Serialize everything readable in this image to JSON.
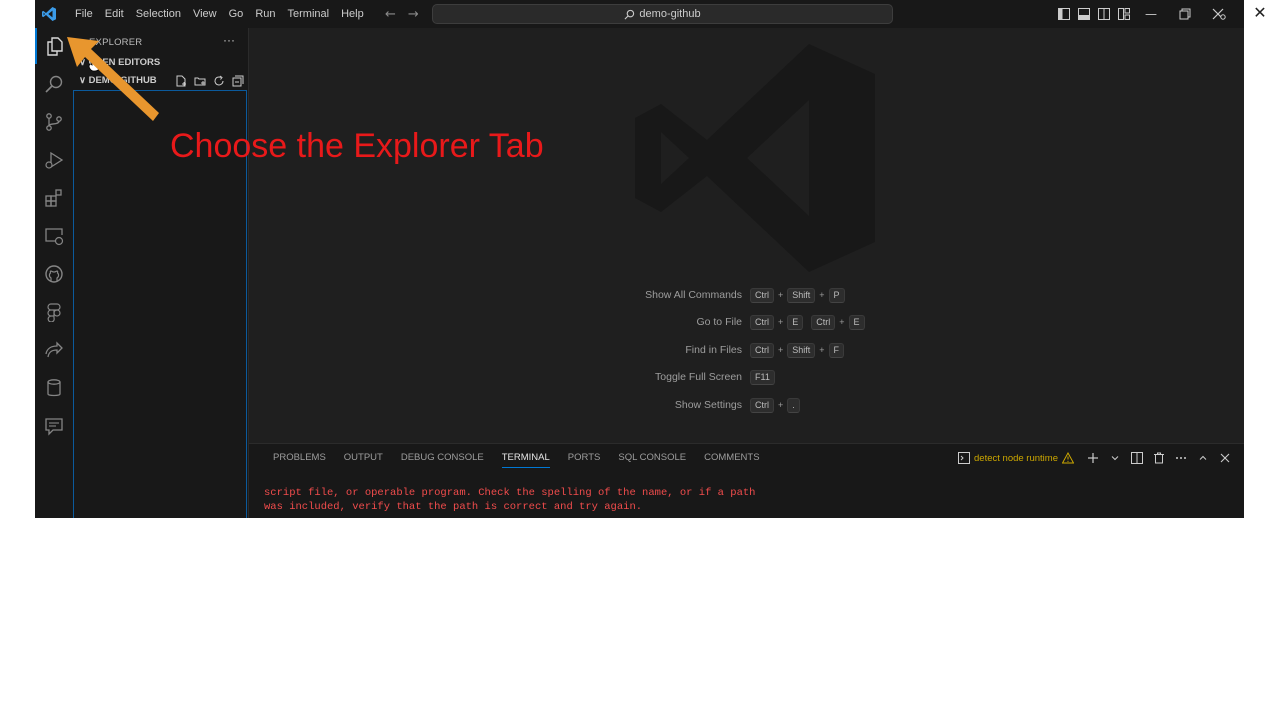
{
  "title_bar": {
    "menu": [
      "File",
      "Edit",
      "Selection",
      "View",
      "Go",
      "Run",
      "Terminal",
      "Help"
    ],
    "search_text": "demo-github",
    "nav_back": "←",
    "nav_forward": "→",
    "minimize": "—",
    "close": "✕"
  },
  "outer_close": "✕",
  "activity_bar": {
    "items": [
      "explorer-icon",
      "search-icon",
      "source-control-icon",
      "run-debug-icon",
      "extensions-icon",
      "remote-explorer-icon",
      "github-icon",
      "figma-icon",
      "live-share-icon",
      "database-icon",
      "comments-icon"
    ]
  },
  "sidebar": {
    "title": "EXPLORER",
    "more": "···",
    "open_editors": "∨  OPEN EDITORS",
    "folder": "∨  DEMO-GITHUB"
  },
  "welcome": {
    "shortcuts": [
      {
        "label": "Show All Commands",
        "keys": [
          "Ctrl",
          "+",
          "Shift",
          "+",
          "P"
        ]
      },
      {
        "label": "Go to File",
        "keys": [
          "Ctrl",
          "+",
          "E",
          " ",
          "Ctrl",
          "+",
          "E"
        ]
      },
      {
        "label": "Find in Files",
        "keys": [
          "Ctrl",
          "+",
          "Shift",
          "+",
          "F"
        ]
      },
      {
        "label": "Toggle Full Screen",
        "keys": [
          "F11"
        ]
      },
      {
        "label": "Show Settings",
        "keys": [
          "Ctrl",
          "+",
          "."
        ]
      }
    ]
  },
  "panel": {
    "tabs": [
      "PROBLEMS",
      "OUTPUT",
      "DEBUG CONSOLE",
      "TERMINAL",
      "PORTS",
      "SQL CONSOLE",
      "COMMENTS"
    ],
    "active_tab": "TERMINAL",
    "task_label": "detect node runtime",
    "terminal_lines": [
      "script file, or operable program. Check the spelling of the name, or if a path",
      "was included, verify that the path is correct and try again."
    ]
  },
  "annotation": {
    "caption": "Choose the Explorer Tab"
  },
  "colors": {
    "accent": "#0078d4",
    "caption": "#e8191a",
    "arrow": "#e8962e",
    "terminal_error": "#f14c4c",
    "warning": "#cca700"
  }
}
